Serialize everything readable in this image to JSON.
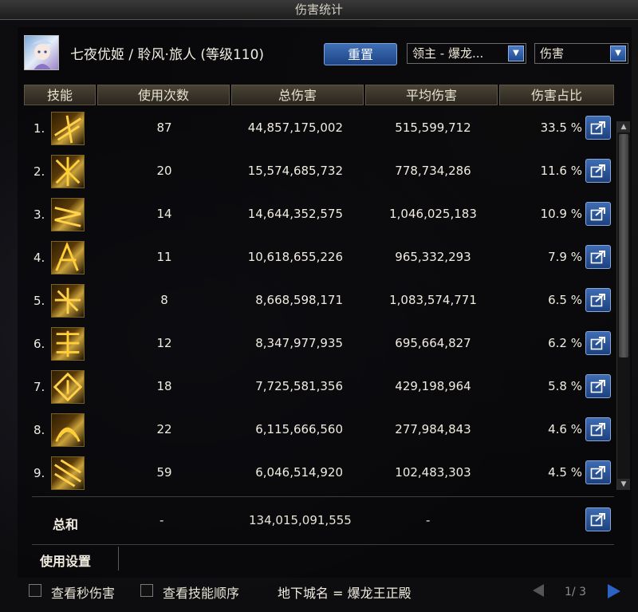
{
  "window": {
    "title": "伤害统计"
  },
  "header": {
    "character": "七夜优姬 / 聆风·旅人 (等级110)",
    "reset_label": "重置",
    "boss_select": "领主 - 爆龙...",
    "metric_select": "伤害"
  },
  "table": {
    "columns": [
      "技能",
      "使用次数",
      "总伤害",
      "平均伤害",
      "伤害占比"
    ],
    "rows": [
      {
        "idx": "1.",
        "count": "87",
        "total": "44,857,175,002",
        "avg": "515,599,712",
        "pct": "33.5 %"
      },
      {
        "idx": "2.",
        "count": "20",
        "total": "15,574,685,732",
        "avg": "778,734,286",
        "pct": "11.6 %"
      },
      {
        "idx": "3.",
        "count": "14",
        "total": "14,644,352,575",
        "avg": "1,046,025,183",
        "pct": "10.9 %"
      },
      {
        "idx": "4.",
        "count": "11",
        "total": "10,618,655,226",
        "avg": "965,332,293",
        "pct": "7.9 %"
      },
      {
        "idx": "5.",
        "count": "8",
        "total": "8,668,598,171",
        "avg": "1,083,574,771",
        "pct": "6.5 %"
      },
      {
        "idx": "6.",
        "count": "12",
        "total": "8,347,977,935",
        "avg": "695,664,827",
        "pct": "6.2 %"
      },
      {
        "idx": "7.",
        "count": "18",
        "total": "7,725,581,356",
        "avg": "429,198,964",
        "pct": "5.8 %"
      },
      {
        "idx": "8.",
        "count": "22",
        "total": "6,115,666,560",
        "avg": "277,984,843",
        "pct": "4.6 %"
      },
      {
        "idx": "9.",
        "count": "59",
        "total": "6,046,514,920",
        "avg": "102,483,303",
        "pct": "4.5 %"
      }
    ]
  },
  "total": {
    "label": "总和",
    "count": "-",
    "sum": "134,015,091,555",
    "avg": "-"
  },
  "settings": {
    "label": "使用设置"
  },
  "footer": {
    "check1": "查看秒伤害",
    "check2": "查看技能顺序",
    "dungeon": "地下城名 = 爆龙王正殿",
    "page": "1/ 3"
  },
  "icons": {
    "share": "share-icon",
    "dropdown": "chevron-down-icon",
    "skill": "skill-icon"
  },
  "colors": {
    "accent": "#2b62c4",
    "header": "#4a4336"
  }
}
